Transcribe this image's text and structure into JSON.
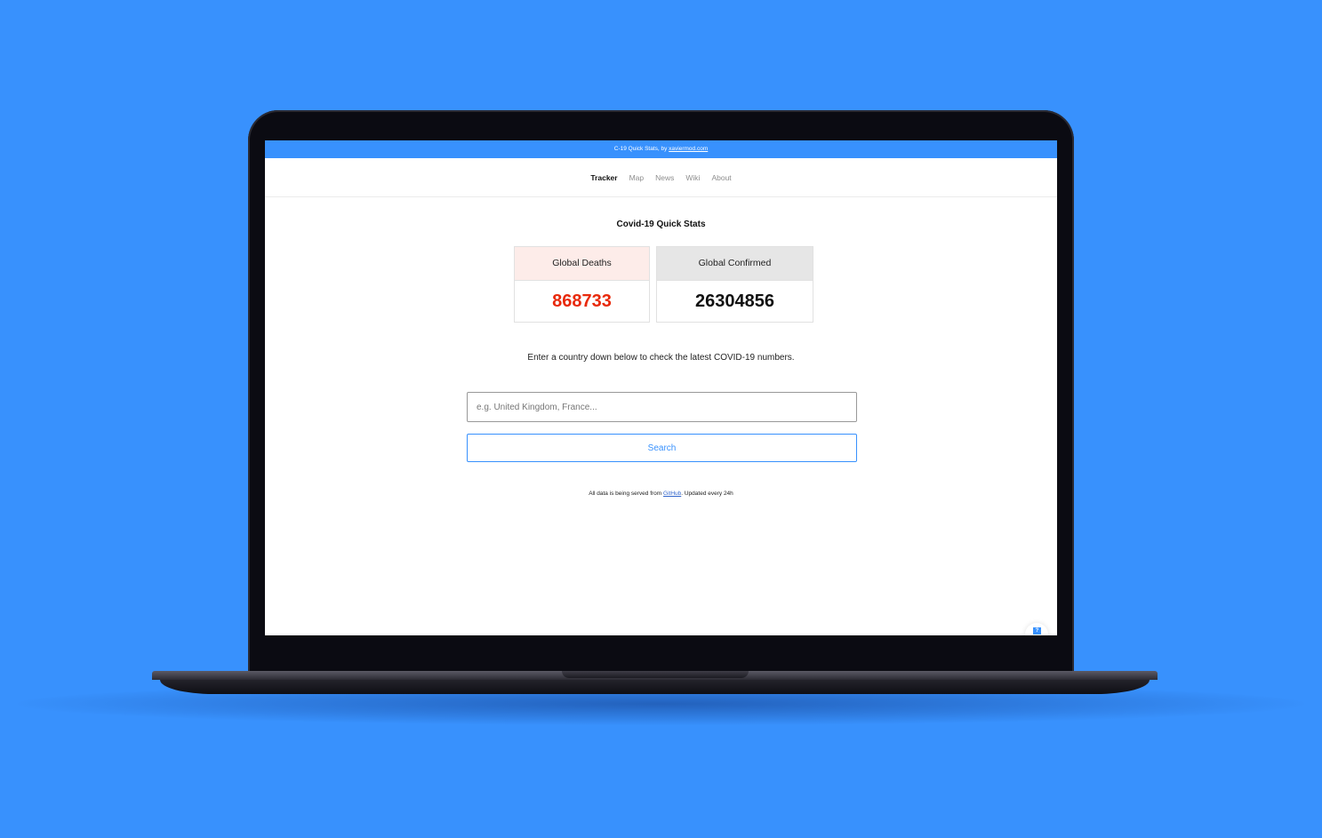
{
  "banner": {
    "prefix": "C-19 Quick Stats, by",
    "link": "xaviermod.com"
  },
  "nav": {
    "items": [
      {
        "label": "Tracker",
        "active": true
      },
      {
        "label": "Map"
      },
      {
        "label": "News"
      },
      {
        "label": "Wiki"
      },
      {
        "label": "About"
      }
    ]
  },
  "main": {
    "title": "Covid-19 Quick Stats",
    "cards": {
      "deaths": {
        "label": "Global Deaths",
        "value": "868733"
      },
      "confirmed": {
        "label": "Global Confirmed",
        "value": "26304856"
      }
    },
    "instructions": "Enter a country down below to check the latest COVID-19 numbers.",
    "search": {
      "placeholder": "e.g. United Kingdom, France...",
      "button_label": "Search"
    },
    "footnote": {
      "prefix": "All data is being served from",
      "link": "GitHub",
      "suffix": ". Updated every 24h"
    }
  },
  "help_widget": {
    "icon": "help-icon",
    "glyph": "?"
  },
  "colors": {
    "background": "#3891fd",
    "accent": "#3891fd",
    "deaths_value": "#e8290b",
    "deaths_header": "#fdece9",
    "confirmed_header": "#e6e6e6"
  }
}
